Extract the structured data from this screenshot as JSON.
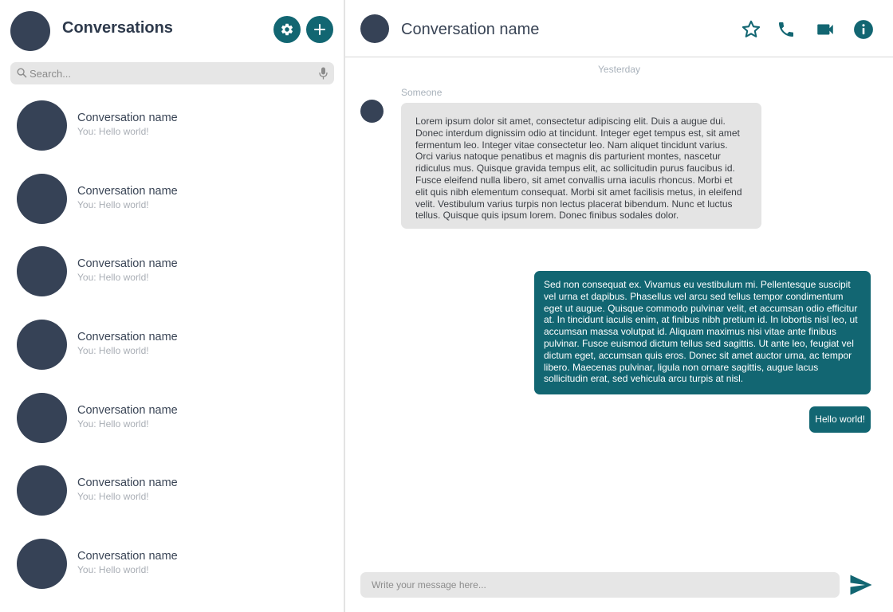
{
  "sidebar": {
    "title": "Conversations",
    "search": {
      "placeholder": "Search..."
    },
    "conversations": [
      {
        "name": "Conversation name",
        "last_message": "You: Hello world!"
      },
      {
        "name": "Conversation name",
        "last_message": "You: Hello world!"
      },
      {
        "name": "Conversation name",
        "last_message": "You: Hello world!"
      },
      {
        "name": "Conversation name",
        "last_message": "You: Hello world!"
      },
      {
        "name": "Conversation name",
        "last_message": "You: Hello world!"
      },
      {
        "name": "Conversation name",
        "last_message": "You: Hello world!"
      },
      {
        "name": "Conversation name",
        "last_message": "You: Hello world!"
      }
    ]
  },
  "header": {
    "title": "Conversation name",
    "icons": [
      "star-icon",
      "phone-icon",
      "video-camera-icon",
      "info-icon"
    ]
  },
  "chat": {
    "day_separator": "Yesterday",
    "messages": [
      {
        "direction": "incoming",
        "sender": "Someone",
        "text": "Lorem ipsum dolor sit amet, consectetur adipiscing elit. Duis a augue dui. Donec interdum dignissim odio at tincidunt. Integer eget tempus est, sit amet fermentum leo. Integer vitae consectetur leo. Nam aliquet tincidunt varius. Orci varius natoque penatibus et magnis dis parturient montes, nascetur ridiculus mus. Quisque gravida tempus elit, ac sollicitudin purus faucibus id. Fusce eleifend nulla libero, sit amet convallis urna iaculis rhoncus. Morbi et elit quis nibh elementum consequat. Morbi sit amet facilisis metus, in eleifend velit. Vestibulum varius turpis non lectus placerat bibendum. Nunc et luctus tellus. Quisque quis ipsum lorem. Donec finibus sodales dolor."
      },
      {
        "direction": "outgoing",
        "text": "Sed non consequat ex. Vivamus eu vestibulum mi. Pellentesque suscipit vel urna et dapibus. Phasellus vel arcu sed tellus tempor condimentum eget ut augue. Quisque commodo pulvinar velit, et accumsan odio efficitur at. In tincidunt iaculis enim, at finibus nibh pretium id. In lobortis nisl leo, ut accumsan massa volutpat id. Aliquam maximus nisi vitae ante finibus pulvinar. Fusce euismod dictum tellus sed sagittis. Ut ante leo, feugiat vel dictum eget, accumsan quis eros. Donec sit amet auctor urna, ac tempor libero. Maecenas pulvinar, ligula non ornare sagittis, augue lacus sollicitudin erat, sed vehicula arcu turpis at nisl."
      },
      {
        "direction": "outgoing",
        "text": "Hello world!"
      }
    ]
  },
  "composer": {
    "placeholder": "Write your message here..."
  },
  "colors": {
    "accent": "#126672",
    "avatar": "#364256",
    "incoming_bubble": "#e4e4e4",
    "input_background": "#e6e6e6"
  }
}
